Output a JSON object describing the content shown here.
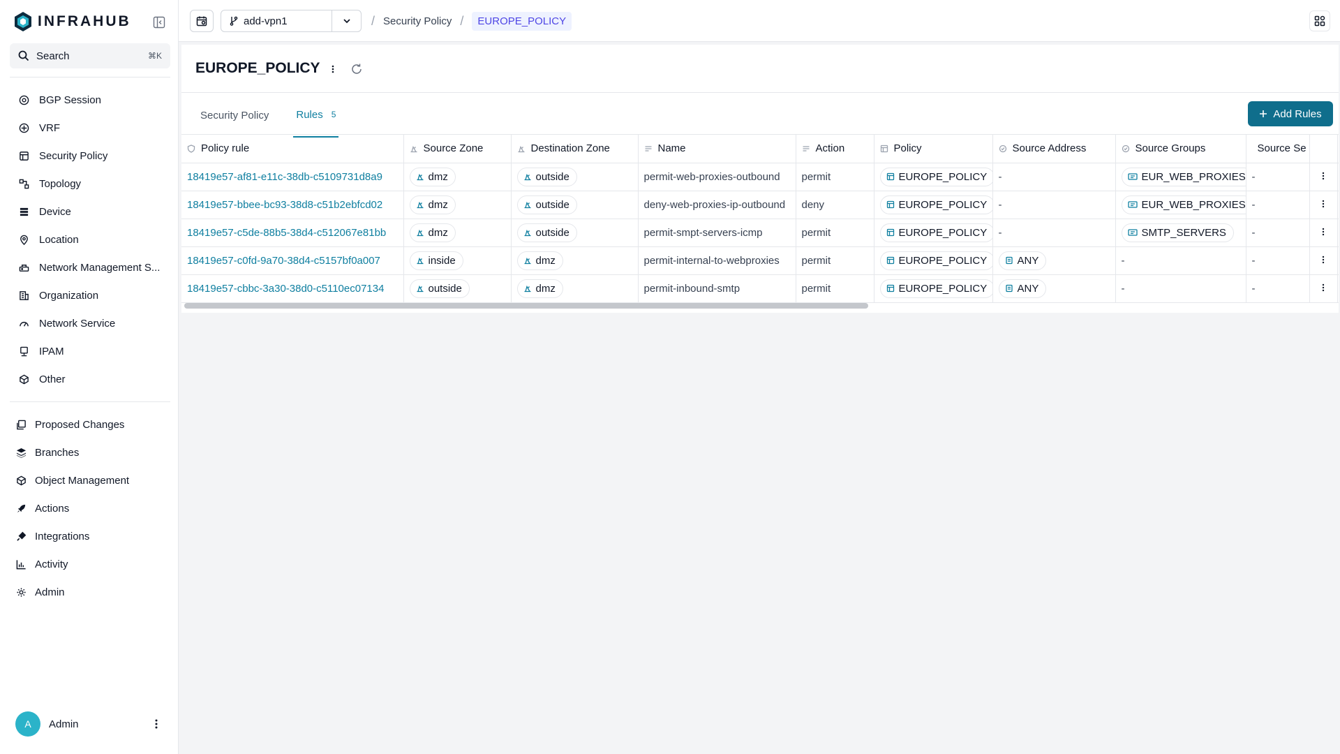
{
  "app": {
    "logo_text": "INFRAHUB"
  },
  "search": {
    "label": "Search",
    "shortcut": "⌘K"
  },
  "sidebar": {
    "items": [
      {
        "label": "BGP Session",
        "icon": "bgp-icon"
      },
      {
        "label": "VRF",
        "icon": "vrf-icon"
      },
      {
        "label": "Security Policy",
        "icon": "security-policy-icon"
      },
      {
        "label": "Topology",
        "icon": "topology-icon"
      },
      {
        "label": "Device",
        "icon": "device-icon"
      },
      {
        "label": "Location",
        "icon": "location-icon"
      },
      {
        "label": "Network Management S...",
        "icon": "network-management-icon"
      },
      {
        "label": "Organization",
        "icon": "organization-icon"
      },
      {
        "label": "Network Service",
        "icon": "network-service-icon"
      },
      {
        "label": "IPAM",
        "icon": "ipam-icon"
      },
      {
        "label": "Other",
        "icon": "other-icon"
      }
    ],
    "bottom_items": [
      {
        "label": "Proposed Changes",
        "icon": "proposed-changes-icon"
      },
      {
        "label": "Branches",
        "icon": "branches-icon"
      },
      {
        "label": "Object Management",
        "icon": "object-management-icon"
      },
      {
        "label": "Actions",
        "icon": "actions-icon"
      },
      {
        "label": "Integrations",
        "icon": "integrations-icon"
      },
      {
        "label": "Activity",
        "icon": "activity-icon"
      },
      {
        "label": "Admin",
        "icon": "admin-icon"
      }
    ],
    "user": {
      "initial": "A",
      "name": "Admin"
    }
  },
  "topbar": {
    "branch": "add-vpn1",
    "breadcrumb": [
      "Security Policy",
      "EUROPE_POLICY"
    ]
  },
  "page": {
    "title": "EUROPE_POLICY",
    "tabs": [
      {
        "label": "Security Policy"
      },
      {
        "label": "Rules",
        "count": "5"
      }
    ],
    "add_button": "Add Rules"
  },
  "table": {
    "columns": [
      "Policy rule",
      "Source Zone",
      "Destination Zone",
      "Name",
      "Action",
      "Policy",
      "Source Address",
      "Source Groups",
      "Source Se"
    ],
    "rows": [
      {
        "id": "18419e57-af81-e11c-38db-c5109731d8a9",
        "source_zone": "dmz",
        "destination_zone": "outside",
        "name": "permit-web-proxies-outbound",
        "action": "permit",
        "policy": "EUROPE_POLICY",
        "source_address": "-",
        "source_groups": "EUR_WEB_PROXIES",
        "source_services": "-"
      },
      {
        "id": "18419e57-bbee-bc93-38d8-c51b2ebfcd02",
        "source_zone": "dmz",
        "destination_zone": "outside",
        "name": "deny-web-proxies-ip-outbound",
        "action": "deny",
        "policy": "EUROPE_POLICY",
        "source_address": "-",
        "source_groups": "EUR_WEB_PROXIES",
        "source_services": "-"
      },
      {
        "id": "18419e57-c5de-88b5-38d4-c512067e81bb",
        "source_zone": "dmz",
        "destination_zone": "outside",
        "name": "permit-smpt-servers-icmp",
        "action": "permit",
        "policy": "EUROPE_POLICY",
        "source_address": "-",
        "source_groups": "SMTP_SERVERS",
        "source_services": "-"
      },
      {
        "id": "18419e57-c0fd-9a70-38d4-c5157bf0a007",
        "source_zone": "inside",
        "destination_zone": "dmz",
        "name": "permit-internal-to-webproxies",
        "action": "permit",
        "policy": "EUROPE_POLICY",
        "source_address": "ANY",
        "source_groups": "-",
        "source_services": "-"
      },
      {
        "id": "18419e57-cbbc-3a30-38d0-c5110ec07134",
        "source_zone": "outside",
        "destination_zone": "dmz",
        "name": "permit-inbound-smtp",
        "action": "permit",
        "policy": "EUROPE_POLICY",
        "source_address": "ANY",
        "source_groups": "-",
        "source_services": "-"
      }
    ]
  },
  "colors": {
    "accent": "#0f7fa0",
    "button": "#0f6e8c",
    "avatar": "#2bb3c9"
  }
}
